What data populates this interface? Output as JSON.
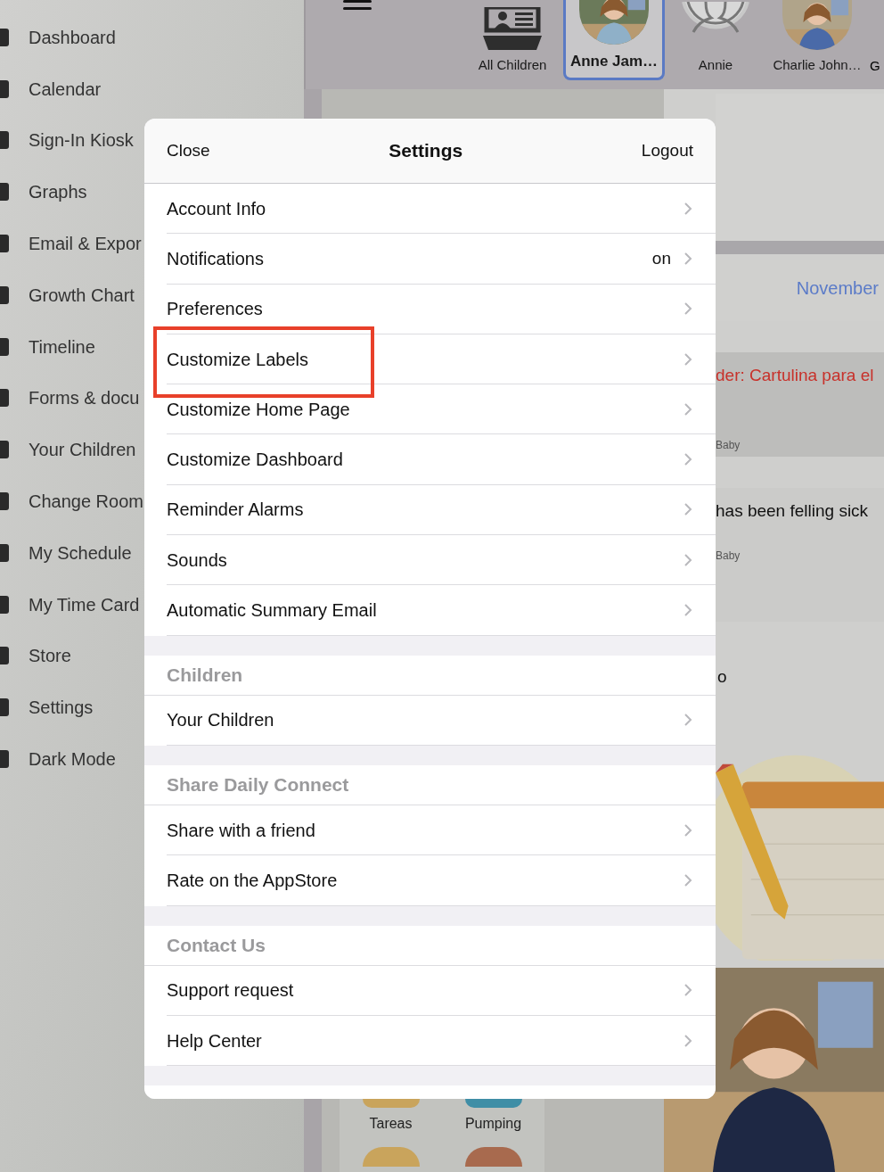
{
  "sidebar": {
    "items": [
      {
        "label": "Dashboard"
      },
      {
        "label": "Calendar"
      },
      {
        "label": "Sign-In Kiosk"
      },
      {
        "label": "Graphs"
      },
      {
        "label": "Email & Expor"
      },
      {
        "label": "Growth Chart"
      },
      {
        "label": "Timeline"
      },
      {
        "label": "Forms & docu"
      },
      {
        "label": "Your Children"
      },
      {
        "label": "Change Room"
      },
      {
        "label": "My Schedule"
      },
      {
        "label": "My Time Card"
      },
      {
        "label": "Store"
      },
      {
        "label": "Settings"
      },
      {
        "label": "Dark Mode"
      }
    ]
  },
  "child_bar": {
    "children": [
      {
        "name": "All Children",
        "kind": "group",
        "selected": false
      },
      {
        "name": "Anne Jam…",
        "selected": true
      },
      {
        "name": "Annie",
        "kind": "placeholder",
        "selected": false
      },
      {
        "name": "Charlie John…",
        "selected": false
      },
      {
        "name": "G",
        "kind": "cut",
        "selected": false
      }
    ]
  },
  "feed": {
    "month": "November",
    "items": [
      {
        "kind": "reminder",
        "text": "der: Cartulina para el",
        "room": "Baby"
      },
      {
        "kind": "note",
        "text": "has been felling sick",
        "room": "Baby"
      },
      {
        "kind": "post",
        "text": "o"
      }
    ]
  },
  "activities": [
    {
      "label": "Tareas",
      "color": "#c9a45c"
    },
    {
      "label": "Pumping",
      "color": "#3f8ea6"
    },
    {
      "color": "#c9a45c"
    },
    {
      "color": "#a86a4e"
    }
  ],
  "settings": {
    "close": "Close",
    "title": "Settings",
    "logout": "Logout",
    "sections": [
      {
        "rows": [
          {
            "label": "Account Info",
            "highlighted": false
          },
          {
            "label": "Notifications",
            "value": "on",
            "highlighted": false
          },
          {
            "label": "Preferences",
            "highlighted": false
          },
          {
            "label": "Customize Labels",
            "highlighted": true
          },
          {
            "label": "Customize Home Page",
            "highlighted": false
          },
          {
            "label": "Customize Dashboard",
            "highlighted": false
          },
          {
            "label": "Reminder Alarms",
            "highlighted": false
          },
          {
            "label": "Sounds",
            "highlighted": false
          },
          {
            "label": "Automatic Summary Email",
            "highlighted": false
          }
        ]
      },
      {
        "title": "Children",
        "rows": [
          {
            "label": "Your Children",
            "highlighted": false
          }
        ]
      },
      {
        "title": "Share Daily Connect",
        "rows": [
          {
            "label": "Share with a friend",
            "highlighted": false
          },
          {
            "label": "Rate on the AppStore",
            "highlighted": false
          }
        ]
      },
      {
        "title": "Contact Us",
        "rows": [
          {
            "label": "Support request",
            "highlighted": false
          },
          {
            "label": "Help Center",
            "highlighted": false
          }
        ]
      }
    ]
  }
}
